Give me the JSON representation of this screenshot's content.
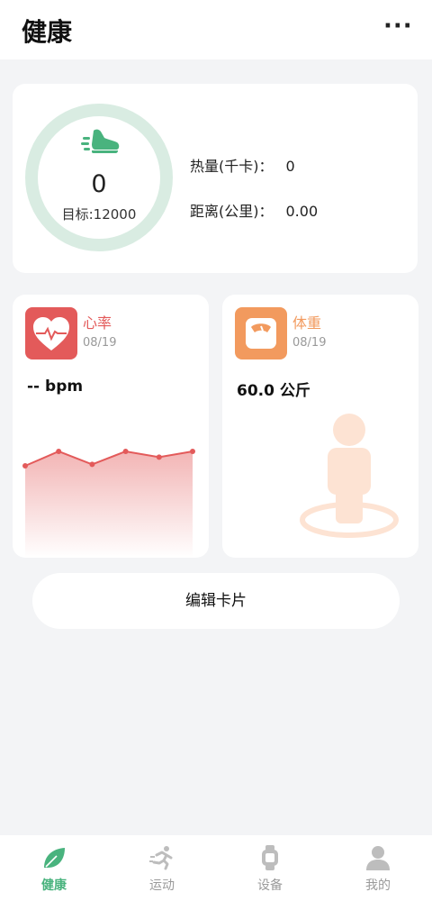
{
  "header": {
    "title": "健康",
    "more_icon": "more-dots-icon",
    "more_glyph": "···"
  },
  "steps_card": {
    "icon": "sneaker-icon",
    "steps": "0",
    "goal_label": "目标:12000",
    "progress": 0,
    "calories_label": "热量(千卡)：",
    "calories_value": "0",
    "distance_label": "距离(公里)：",
    "distance_value": "0.00"
  },
  "heart_card": {
    "icon": "heart-rate-icon",
    "name": "心率",
    "date": "08/19",
    "value": "-- bpm",
    "color": "#e35a5a",
    "trend": [
      3,
      5,
      3.2,
      5,
      4.2,
      5
    ]
  },
  "weight_card": {
    "icon": "scale-icon",
    "name": "体重",
    "date": "08/19",
    "value": "60.0 公斤",
    "color": "#f29a5e",
    "illustration": "person-on-scale-icon"
  },
  "edit_button": {
    "label": "编辑卡片"
  },
  "tabbar": {
    "active_color": "#49b37e",
    "items": [
      {
        "label": "健康",
        "icon": "leaf-icon",
        "active": true
      },
      {
        "label": "运动",
        "icon": "running-icon",
        "active": false
      },
      {
        "label": "设备",
        "icon": "watch-icon",
        "active": false
      },
      {
        "label": "我的",
        "icon": "user-icon",
        "active": false
      }
    ]
  }
}
